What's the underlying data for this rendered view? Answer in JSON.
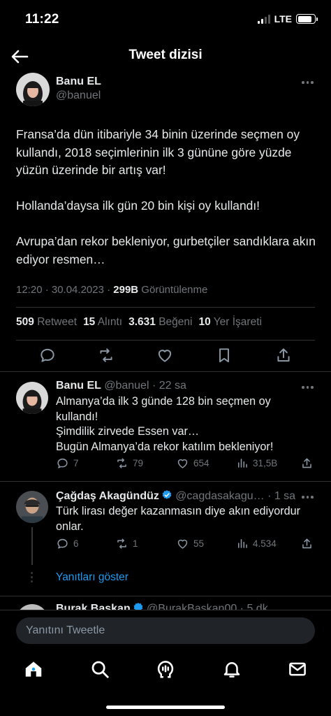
{
  "status": {
    "time": "11:22",
    "network": "LTE",
    "battery_level": 0.85
  },
  "header": {
    "title": "Tweet dizisi"
  },
  "main_tweet": {
    "name": "Banu EL",
    "handle": "@banuel",
    "paragraphs": [
      "Fransa’da dün itibariyle 34 binin üzerinde seçmen oy kullandı, 2018 seçimlerinin ilk 3 gününe göre yüzde yüzün üzerinde bir artış var!",
      "Hollanda’daysa ilk gün 20 bin kişi oy kullandı!",
      "Avrupa’dan rekor bekleniyor, gurbetçiler sandıklara akın ediyor resmen…"
    ],
    "timestamp": "12:20 · 30.04.2023 · ",
    "views_count": "299B",
    "views_label": " Görüntülenme",
    "stats": [
      {
        "count": "509",
        "label": "Retweet"
      },
      {
        "count": "15",
        "label": "Alıntı"
      },
      {
        "count": "3.631",
        "label": "Beğeni"
      },
      {
        "count": "10",
        "label": "Yer İşareti"
      }
    ]
  },
  "replies": [
    {
      "name": "Banu EL",
      "meta": "@banuel · 22 sa",
      "lines": [
        "Almanya’da ilk 3 günde 128 bin seçmen oy",
        "kullandı!",
        "Şimdilik zirvede Essen var…",
        "Bugün Almanya’da rekor katılım bekleniyor!"
      ],
      "replies": "7",
      "retweets": "79",
      "likes": "654",
      "views": "31,5B"
    },
    {
      "name": "Çağdaş Akagündüz",
      "meta": "@cagdasakagu… · 1 sa",
      "lines": [
        "Türk lirası değer kazanmasın diye akın ediyordur",
        "onlar."
      ],
      "replies": "6",
      "retweets": "1",
      "likes": "55",
      "views": "4.534"
    },
    {
      "name": "Burak Başkan",
      "meta": "@BurakBaskan00 · 5 dk"
    }
  ],
  "show_replies_label": "Yanıtları göster",
  "composer": {
    "placeholder": "Yanıtını Tweetle"
  },
  "colors": {
    "accent": "#1d9bf0",
    "background": "#000000",
    "muted": "#71767b"
  }
}
